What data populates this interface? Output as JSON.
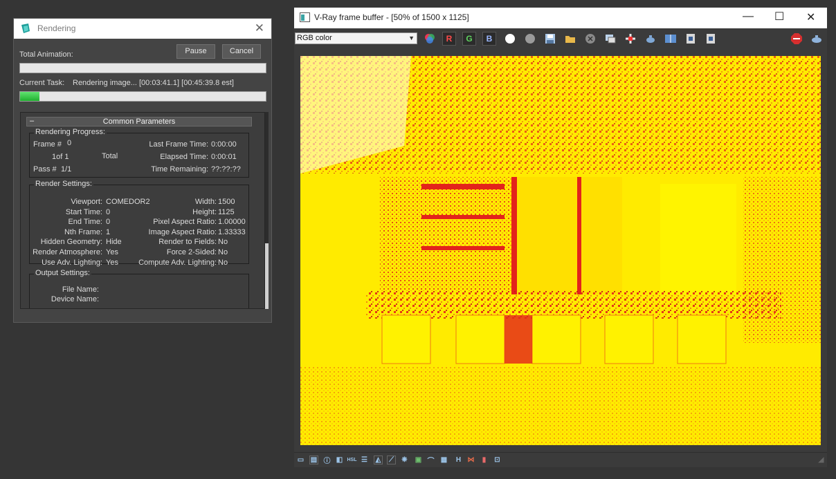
{
  "rendering_dialog": {
    "title": "Rendering",
    "total_animation_label": "Total Animation:",
    "pause_label": "Pause",
    "cancel_label": "Cancel",
    "current_task_label": "Current Task:",
    "current_task_value": "Rendering image... [00:03:41.1] [00:45:39.8 est]",
    "total_progress": 0,
    "task_progress": 0.08,
    "rollout_title": "Common Parameters",
    "rollout_toggle": "–",
    "rendering_progress": {
      "title": "Rendering Progress:",
      "frame_label": "Frame #",
      "frame_value": "0",
      "of_value": "1of 1",
      "total_label": "Total",
      "pass_label": "Pass #",
      "pass_value": "1/1",
      "last_frame_time_label": "Last Frame Time:",
      "last_frame_time_value": "0:00:00",
      "elapsed_time_label": "Elapsed Time:",
      "elapsed_time_value": "0:00:01",
      "time_remaining_label": "Time Remaining:",
      "time_remaining_value": "??:??:??"
    },
    "render_settings": {
      "title": "Render Settings:",
      "left": [
        {
          "label": "Viewport:",
          "value": "COMEDOR2"
        },
        {
          "label": "Start Time:",
          "value": "0"
        },
        {
          "label": "End Time:",
          "value": "0"
        },
        {
          "label": "Nth Frame:",
          "value": "1"
        },
        {
          "label": "Hidden Geometry:",
          "value": "Hide"
        },
        {
          "label": "Render Atmosphere:",
          "value": "Yes"
        },
        {
          "label": "Use Adv. Lighting:",
          "value": "Yes"
        }
      ],
      "right": [
        {
          "label": "Width:",
          "value": "1500"
        },
        {
          "label": "Height:",
          "value": "1125"
        },
        {
          "label": "Pixel Aspect Ratio:",
          "value": "1.00000"
        },
        {
          "label": "Image Aspect Ratio:",
          "value": "1.33333"
        },
        {
          "label": "Render to Fields:",
          "value": "No"
        },
        {
          "label": "Force 2-Sided:",
          "value": "No"
        },
        {
          "label": "Compute Adv. Lighting:",
          "value": "No"
        }
      ]
    },
    "output_settings": {
      "title": "Output Settings:",
      "file_name_label": "File Name:",
      "device_name_label": "Device Name:"
    }
  },
  "vfb": {
    "title": "V-Ray frame buffer - [50% of 1500 x 1125]",
    "channel_select": "RGB color",
    "channel_buttons": {
      "r": "R",
      "g": "G",
      "b": "B"
    },
    "colors": {
      "canvas": "#ffeb00",
      "hot": "#e3231b",
      "mid": "#f07a12"
    },
    "toolbar_icons": [
      "color-wheel-icon",
      "red-channel-icon",
      "green-channel-icon",
      "blue-channel-icon",
      "white-dot-icon",
      "gray-dot-icon",
      "save-icon",
      "open-folder-icon",
      "clear-icon",
      "copy-icon",
      "region-render-icon",
      "teapot-icon",
      "compare-icon",
      "history-icon",
      "history-2-icon",
      "stop-icon",
      "render-teapot-icon"
    ],
    "bottom_icons": [
      "display-icon",
      "lut-icon",
      "info-icon",
      "exposure-icon",
      "hsl-icon",
      "levels-icon",
      "histogram-icon",
      "curve-icon",
      "lens-icon",
      "image-icon",
      "graph-icon",
      "ocio-icon",
      "h-icon",
      "crop-icon",
      "stamp-icon",
      "settings-icon"
    ],
    "bottom_labels": {
      "h": "H",
      "hsl": "HSL"
    }
  }
}
